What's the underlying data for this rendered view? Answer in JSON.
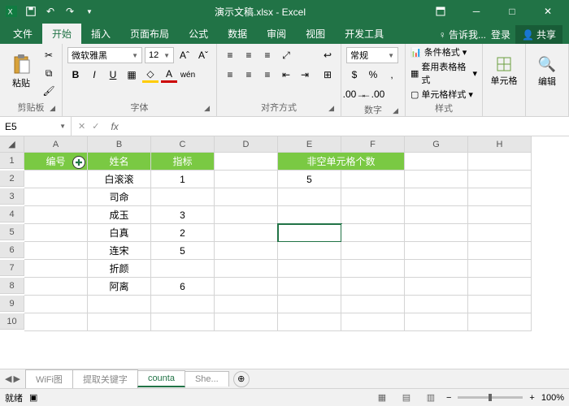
{
  "title": "演示文稿.xlsx - Excel",
  "tabs": {
    "file": "文件",
    "home": "开始",
    "insert": "插入",
    "layout": "页面布局",
    "formulas": "公式",
    "data": "数据",
    "review": "审阅",
    "view": "视图",
    "dev": "开发工具",
    "tell": "告诉我...",
    "login": "登录",
    "share": "共享"
  },
  "ribbon": {
    "paste": "粘贴",
    "clipboard_label": "剪贴板",
    "font_name": "微软雅黑",
    "font_size": "12",
    "font_label": "字体",
    "align_label": "对齐方式",
    "wen": "wén",
    "number_format": "常规",
    "number_label": "数字",
    "cond_fmt": "条件格式",
    "table_fmt": "套用表格格式",
    "cell_style": "单元格样式",
    "styles_label": "样式",
    "cells": "单元格",
    "edit": "编辑"
  },
  "namebox": "E5",
  "colhdrs": [
    "A",
    "B",
    "C",
    "D",
    "E",
    "F",
    "G",
    "H"
  ],
  "table": {
    "h1": "编号",
    "h2": "姓名",
    "h3": "指标",
    "h4": "非空单元格个数",
    "rows": [
      {
        "b": "白滚滚",
        "c": "1",
        "e": "5"
      },
      {
        "b": "司命",
        "c": ""
      },
      {
        "b": "成玉",
        "c": "3"
      },
      {
        "b": "白真",
        "c": "2"
      },
      {
        "b": "连宋",
        "c": "5"
      },
      {
        "b": "折颜",
        "c": ""
      },
      {
        "b": "阿离",
        "c": "6"
      }
    ]
  },
  "sheets": {
    "s1": "WiFi图",
    "s2": "提取关键字",
    "s3": "counta",
    "s4": "She..."
  },
  "status": {
    "ready": "就绪",
    "zoom": "100%"
  }
}
